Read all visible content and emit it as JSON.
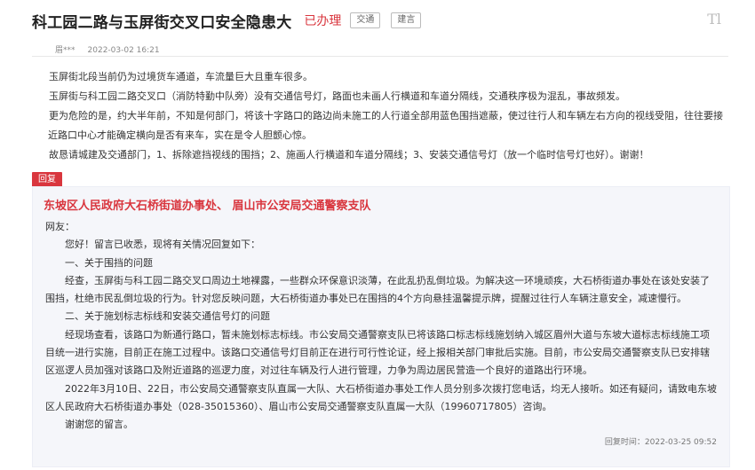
{
  "header": {
    "title": "科工园二路与玉屏街交叉口安全隐患大",
    "status": "已办理",
    "tags": [
      "交通",
      "建言"
    ],
    "font_toggle": "Tl"
  },
  "meta": {
    "author": "眉***",
    "date": "2022-03-02 16:21"
  },
  "content": {
    "paragraphs": [
      "玉屏街北段当前仍为过境货车通道，车流量巨大且重车很多。",
      "玉屏街与科工园二路交叉口（消防特勤中队旁）没有交通信号灯，路面也未画人行横道和车道分隔线，交通秩序极为混乱，事故频发。",
      "更为危险的是，约大半年前，不知是何部门，将该十字路口的路边尚未施工的人行道全部用蓝色围挡遮蔽，使过往行人和车辆左右方向的视线受阻，往往要接近路口中心才能确定横向是否有来车，实在是令人胆颤心惊。",
      "故恳请城建及交通部门，1、拆除遮挡视线的围挡；2、施画人行横道和车道分隔线；3、安装交通信号灯（放一个临时信号灯也好）。谢谢！"
    ]
  },
  "reply": {
    "badge": "回复",
    "org": "东坡区人民政府大石桥街道办事处、 眉山市公安局交通警察支队",
    "lines": [
      "网友：",
      "您好！留言已收悉，现将有关情况回复如下：",
      "一、关于围挡的问题",
      "经查，玉屏街与科工园二路交叉口周边土地裸露，一些群众环保意识淡薄，在此乱扔乱倒垃圾。为解决这一环境顽疾，大石桥街道办事处在该处安装了围挡，杜绝市民乱倒垃圾的行为。针对您反映问题，大石桥街道办事处已在围挡的4个方向悬挂温馨提示牌，提醒过往行人车辆注意安全，减速慢行。",
      "二、关于施划标志标线和安装交通信号灯的问题",
      "经现场查看，该路口为新通行路口，暂未施划标志标线。市公安局交通警察支队已将该路口标志标线施划纳入城区眉州大道与东坡大道标志标线施工项目统一进行实施，目前正在施工过程中。该路口交通信号灯目前正在进行可行性论证，经上报相关部门审批后实施。目前，市公安局交通警察支队已安排辖区巡逻人员加强对该路口及附近道路的巡逻力度，对过往车辆及行人进行管理，力争为周边居民营造一个良好的道路出行环境。",
      "2022年3月10日、22日，市公安局交通警察支队直属一大队、大石桥街道办事处工作人员分别多次拨打您电话，均无人接听。如还有疑问，请致电东坡区人民政府大石桥街道办事处（028-35015360）、眉山市公安局交通警察支队直属一大队（19960717805）咨询。",
      "谢谢您的留言。"
    ],
    "reply_time": "回复时间：2022-03-25 09:52"
  },
  "colors": {
    "accent": "#d9363e",
    "reply_bg": "#f5f6fa"
  }
}
